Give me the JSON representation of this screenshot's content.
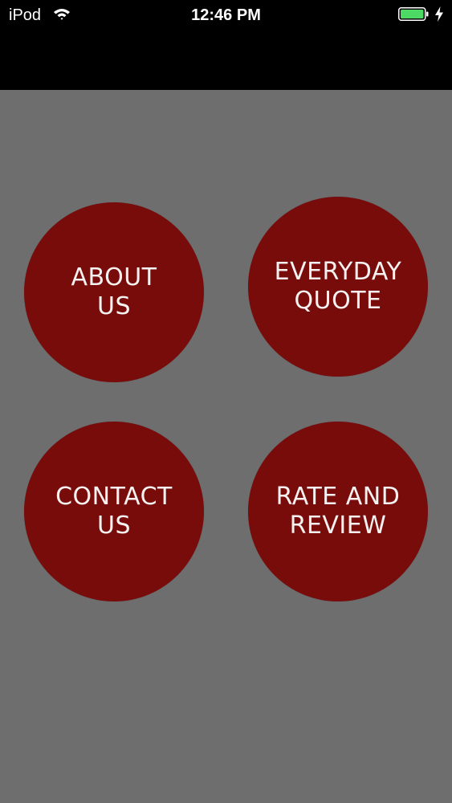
{
  "status_bar": {
    "carrier": "iPod",
    "time": "12:46 PM",
    "icons": [
      "wifi-icon",
      "battery-icon",
      "charging-bolt-icon"
    ],
    "battery_color": "#4cd964"
  },
  "menu": {
    "buttons": [
      {
        "label": "ABOUT\nUS"
      },
      {
        "label": "EVERYDAY\nQUOTE"
      },
      {
        "label": "CONTACT\nUS"
      },
      {
        "label": "RATE AND\nREVIEW"
      }
    ]
  },
  "colors": {
    "status_bar_bg": "#000000",
    "content_bg": "#6f6e6f",
    "circle_bg": "#780c0b",
    "circle_text": "#f4f1f1"
  }
}
